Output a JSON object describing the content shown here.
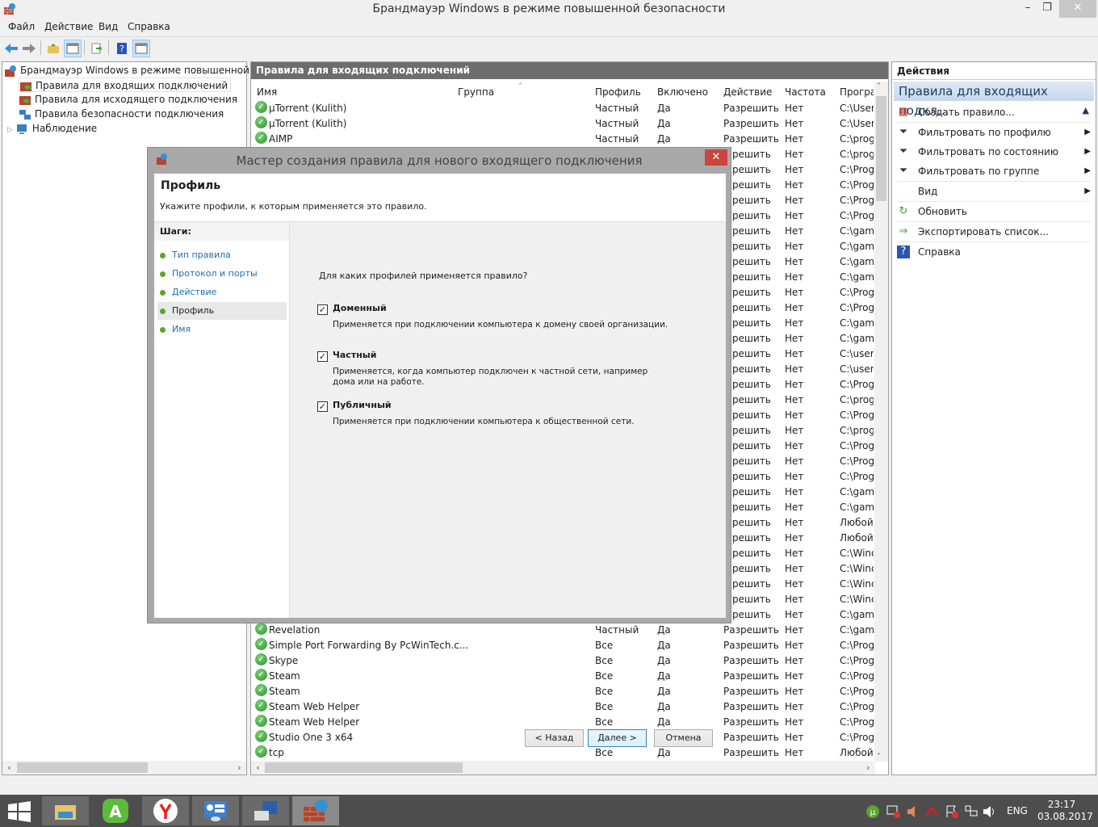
{
  "window": {
    "title": "Брандмауэр Windows в режиме повышенной безопасности",
    "minimize": "–",
    "maximize": "❐",
    "close": "✕"
  },
  "menu": [
    "Файл",
    "Действие",
    "Вид",
    "Справка"
  ],
  "tree": {
    "root": "Брандмауэр Windows в режиме повышенной безопасности",
    "items": [
      "Правила для входящих подключений",
      "Правила для исходящего подключения",
      "Правила безопасности подключения",
      "Наблюдение"
    ],
    "expander": "▷"
  },
  "list": {
    "title": "Правила для входящих подключений",
    "columns": [
      "Имя",
      "Группа",
      "Профиль",
      "Включено",
      "Действие",
      "Частота",
      "Програ"
    ],
    "sort_indicator": "˄",
    "rows_top": [
      {
        "name": "µTorrent (Kulith)",
        "profile": "Частный",
        "enabled": "Да",
        "action": "Разрешить",
        "override": "Нет",
        "program": "C:\\Users"
      },
      {
        "name": "µTorrent (Kulith)",
        "profile": "Частный",
        "enabled": "Да",
        "action": "Разрешить",
        "override": "Нет",
        "program": "C:\\Users"
      },
      {
        "name": "AIMP",
        "profile": "Частный",
        "enabled": "Да",
        "action": "Разрешить",
        "override": "Нет",
        "program": "C:\\prog"
      }
    ],
    "rows_hidden_visible_right": [
      {
        "action": "решить",
        "override": "Нет",
        "program": "C:\\prog"
      },
      {
        "action": "решить",
        "override": "Нет",
        "program": "C:\\Prog"
      },
      {
        "action": "решить",
        "override": "Нет",
        "program": "C:\\Prog"
      },
      {
        "action": "решить",
        "override": "Нет",
        "program": "C:\\Prog"
      },
      {
        "action": "решить",
        "override": "Нет",
        "program": "C:\\Prog"
      },
      {
        "action": "решить",
        "override": "Нет",
        "program": "C:\\gam"
      },
      {
        "action": "решить",
        "override": "Нет",
        "program": "C:\\gam"
      },
      {
        "action": "решить",
        "override": "Нет",
        "program": "C:\\gam"
      },
      {
        "action": "решить",
        "override": "Нет",
        "program": "C:\\gam"
      },
      {
        "action": "решить",
        "override": "Нет",
        "program": "C:\\Prog"
      },
      {
        "action": "решить",
        "override": "Нет",
        "program": "C:\\Prog"
      },
      {
        "action": "решить",
        "override": "Нет",
        "program": "C:\\gam"
      },
      {
        "action": "решить",
        "override": "Нет",
        "program": "C:\\gam"
      },
      {
        "action": "решить",
        "override": "Нет",
        "program": "C:\\users"
      },
      {
        "action": "решить",
        "override": "Нет",
        "program": "C:\\users"
      },
      {
        "action": "решить",
        "override": "Нет",
        "program": "C:\\Prog"
      },
      {
        "action": "решить",
        "override": "Нет",
        "program": "C:\\prog"
      },
      {
        "action": "решить",
        "override": "Нет",
        "program": "C:\\Prog"
      },
      {
        "action": "решить",
        "override": "Нет",
        "program": "C:\\prog"
      },
      {
        "action": "решить",
        "override": "Нет",
        "program": "C:\\Prog"
      },
      {
        "action": "решить",
        "override": "Нет",
        "program": "C:\\Prog"
      },
      {
        "action": "решить",
        "override": "Нет",
        "program": "C:\\Prog"
      },
      {
        "action": "решить",
        "override": "Нет",
        "program": "C:\\gam"
      },
      {
        "action": "решить",
        "override": "Нет",
        "program": "C:\\gam"
      },
      {
        "action": "решить",
        "override": "Нет",
        "program": "Любой"
      },
      {
        "action": "решить",
        "override": "Нет",
        "program": "Любой"
      },
      {
        "action": "решить",
        "override": "Нет",
        "program": "C:\\Winc"
      },
      {
        "action": "решить",
        "override": "Нет",
        "program": "C:\\Winc"
      },
      {
        "action": "решить",
        "override": "Нет",
        "program": "C:\\Winc"
      },
      {
        "action": "решить",
        "override": "Нет",
        "program": "C:\\Winc"
      },
      {
        "action": "решить",
        "override": "Нет",
        "program": "C:\\gam"
      }
    ],
    "rows_bottom": [
      {
        "name": "Revelation",
        "profile": "Частный",
        "enabled": "Да",
        "action": "Разрешить",
        "override": "Нет",
        "program": "C:\\gam"
      },
      {
        "name": "Simple Port Forwarding By PcWinTech.c...",
        "profile": "Все",
        "enabled": "Да",
        "action": "Разрешить",
        "override": "Нет",
        "program": "C:\\Prog"
      },
      {
        "name": "Skype",
        "profile": "Все",
        "enabled": "Да",
        "action": "Разрешить",
        "override": "Нет",
        "program": "C:\\Prog"
      },
      {
        "name": "Steam",
        "profile": "Все",
        "enabled": "Да",
        "action": "Разрешить",
        "override": "Нет",
        "program": "C:\\Prog"
      },
      {
        "name": "Steam",
        "profile": "Все",
        "enabled": "Да",
        "action": "Разрешить",
        "override": "Нет",
        "program": "C:\\Prog"
      },
      {
        "name": "Steam Web Helper",
        "profile": "Все",
        "enabled": "Да",
        "action": "Разрешить",
        "override": "Нет",
        "program": "C:\\Prog"
      },
      {
        "name": "Steam Web Helper",
        "profile": "Все",
        "enabled": "Да",
        "action": "Разрешить",
        "override": "Нет",
        "program": "C:\\Prog"
      },
      {
        "name": "Studio One 3 x64",
        "profile": "Все",
        "enabled": "Да",
        "action": "Разрешить",
        "override": "Нет",
        "program": "C:\\Prog"
      },
      {
        "name": "tcp",
        "profile": "Все",
        "enabled": "Да",
        "action": "Разрешить",
        "override": "Нет",
        "program": "Любой"
      }
    ]
  },
  "actions": {
    "title": "Действия",
    "section": "Правила для входящих подкл...",
    "items": [
      {
        "label": "Создать правило...",
        "icon": "new-rule-icon"
      },
      {
        "label": "Фильтровать по профилю",
        "icon": "filter-icon",
        "submenu": true
      },
      {
        "label": "Фильтровать по состоянию",
        "icon": "filter-icon",
        "submenu": true
      },
      {
        "label": "Фильтровать по группе",
        "icon": "filter-icon",
        "submenu": true
      },
      {
        "label": "Вид",
        "icon": "",
        "submenu": true
      },
      {
        "label": "Обновить",
        "icon": "refresh-icon"
      },
      {
        "label": "Экспортировать список...",
        "icon": "export-icon"
      },
      {
        "label": "Справка",
        "icon": "help-icon"
      }
    ]
  },
  "dialog": {
    "title": "Мастер создания правила для нового входящего подключения",
    "heading": "Профиль",
    "subheading": "Укажите профили, к которым применяется это правило.",
    "steps_label": "Шаги:",
    "steps": [
      "Тип правила",
      "Протокол и порты",
      "Действие",
      "Профиль",
      "Имя"
    ],
    "current_step": "Профиль",
    "question": "Для каких профилей применяется правило?",
    "profiles": [
      {
        "label": "Доменный",
        "checked": true,
        "description": "Применяется при подключении компьютера к домену своей организации."
      },
      {
        "label": "Частный",
        "checked": true,
        "description": "Применяется, когда компьютер подключен к частной сети, например дома или на работе."
      },
      {
        "label": "Публичный",
        "checked": true,
        "description": "Применяется при подключении компьютера к общественной сети."
      }
    ],
    "buttons": {
      "back": "< Назад",
      "next": "Далее >",
      "cancel": "Отмена"
    }
  },
  "taskbar": {
    "apps": [
      "file-explorer",
      "android-app",
      "yandex-browser",
      "control-panel",
      "network-setup",
      "firewall"
    ],
    "language": "ENG",
    "time": "23:17",
    "date": "03.08.2017"
  }
}
